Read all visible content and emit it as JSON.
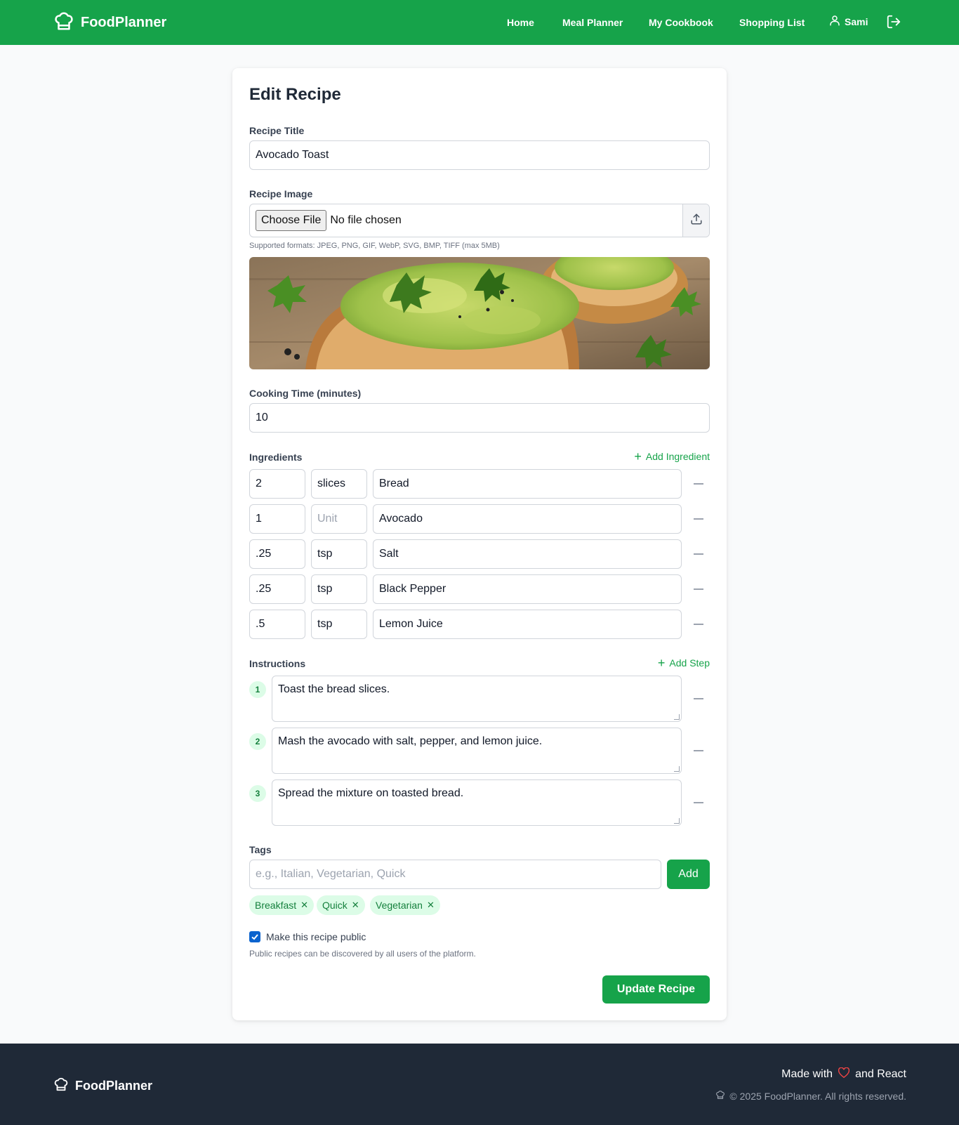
{
  "header": {
    "brand": "FoodPlanner",
    "nav": [
      "Home",
      "Meal Planner",
      "My Cookbook",
      "Shopping List"
    ],
    "user": "Sami"
  },
  "form": {
    "heading": "Edit Recipe",
    "title_label": "Recipe Title",
    "title_value": "Avocado Toast",
    "image_label": "Recipe Image",
    "choose_file": "Choose File",
    "no_file": "No file chosen",
    "formats_hint": "Supported formats: JPEG, PNG, GIF, WebP, SVG, BMP, TIFF (max 5MB)",
    "time_label": "Cooking Time (minutes)",
    "time_value": "10",
    "ingredients_label": "Ingredients",
    "add_ingredient": "Add Ingredient",
    "unit_placeholder": "Unit",
    "ingredients": [
      {
        "qty": "2",
        "unit": "slices",
        "name": "Bread"
      },
      {
        "qty": "1",
        "unit": "",
        "name": "Avocado"
      },
      {
        "qty": ".25",
        "unit": "tsp",
        "name": "Salt"
      },
      {
        "qty": ".25",
        "unit": "tsp",
        "name": "Black Pepper"
      },
      {
        "qty": ".5",
        "unit": "tsp",
        "name": "Lemon Juice"
      }
    ],
    "instructions_label": "Instructions",
    "add_step": "Add Step",
    "steps": [
      {
        "num": "1",
        "text": "Toast the bread slices."
      },
      {
        "num": "2",
        "text": "Mash the avocado with salt, pepper, and lemon juice."
      },
      {
        "num": "3",
        "text": "Spread the mixture on toasted bread."
      }
    ],
    "tags_label": "Tags",
    "tags_placeholder": "e.g., Italian, Vegetarian, Quick",
    "add_tag": "Add",
    "tags": [
      "Breakfast",
      "Quick",
      "Vegetarian"
    ],
    "public_label": "Make this recipe public",
    "public_checked": true,
    "public_hint": "Public recipes can be discovered by all users of the platform.",
    "submit": "Update Recipe"
  },
  "footer": {
    "brand": "FoodPlanner",
    "made_with_prefix": "Made with",
    "made_with_suffix": "and React",
    "copyright": "© 2025 FoodPlanner. All rights reserved."
  },
  "colors": {
    "brand_green": "#16a34a",
    "tag_bg": "#dcfce7",
    "footer_bg": "#1f2937",
    "heart": "#ef4444"
  }
}
